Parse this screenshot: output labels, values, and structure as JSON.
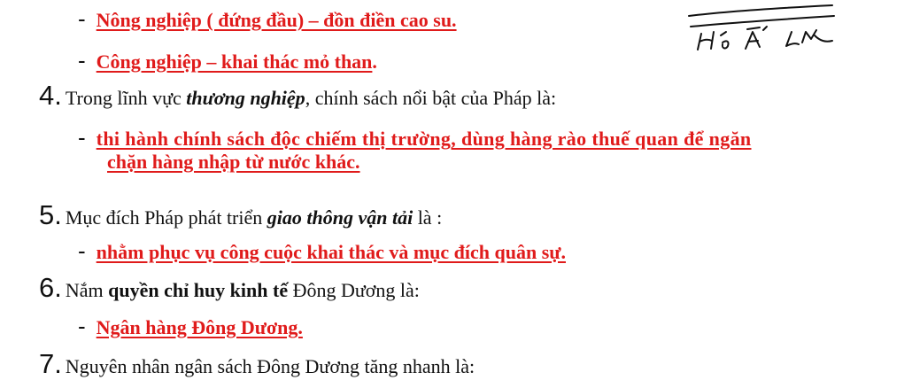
{
  "items": [
    {
      "dash": "-",
      "answer": "Nông nghiệp ( đứng đầu) – đồn điền cao su."
    },
    {
      "dash": "-",
      "answer": "Công nghiệp – khai thác mỏ than",
      "suffix": "."
    }
  ],
  "q4": {
    "number": "4.",
    "text_a": "Trong lĩnh vực ",
    "emph": "thương nghiệp",
    "text_b": ", chính sách nổi bật của Pháp là:",
    "dash": "-",
    "answer_line1": "thi hành chính sách độc chiếm thị trường, dùng hàng rào thuế quan để ngăn",
    "answer_line2": "chặn hàng nhập từ nước khác."
  },
  "q5": {
    "number": "5.",
    "text_a": "Mục đích Pháp phát triển ",
    "emph": "giao thông vận tải",
    "text_b": " là :",
    "dash": "-",
    "answer": "nhằm phục vụ công cuộc khai thác và mục đích quân sự."
  },
  "q6": {
    "number": "6.",
    "text_a": "Nắm ",
    "emph": "quyền chỉ huy kinh tế",
    "text_b": " Đông Dương là:",
    "dash": "-",
    "answer": "Ngân hàng Đông Dương."
  },
  "q7": {
    "number": "7.",
    "text": "Nguyên nhân ngân sách Đông Dương tăng nhanh là:"
  },
  "handwriting": "Hỏi Ái LyL",
  "colors": {
    "answer": "#e01b1b",
    "text": "#111111"
  }
}
